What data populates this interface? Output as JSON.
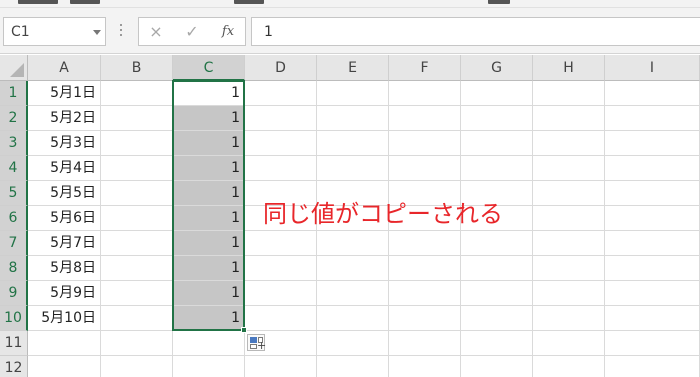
{
  "name_box": {
    "value": "C1"
  },
  "formula_bar": {
    "cancel_icon": "×",
    "enter_icon": "✓",
    "function_icon": "fx",
    "value": "1"
  },
  "columns": [
    "A",
    "B",
    "C",
    "D",
    "E",
    "F",
    "G",
    "H",
    "I"
  ],
  "selected_column": "C",
  "rows": [
    {
      "num": "1",
      "a": "5月1日",
      "c": "1"
    },
    {
      "num": "2",
      "a": "5月2日",
      "c": "1"
    },
    {
      "num": "3",
      "a": "5月3日",
      "c": "1"
    },
    {
      "num": "4",
      "a": "5月4日",
      "c": "1"
    },
    {
      "num": "5",
      "a": "5月5日",
      "c": "1"
    },
    {
      "num": "6",
      "a": "5月6日",
      "c": "1"
    },
    {
      "num": "7",
      "a": "5月7日",
      "c": "1"
    },
    {
      "num": "8",
      "a": "5月8日",
      "c": "1"
    },
    {
      "num": "9",
      "a": "5月9日",
      "c": "1"
    },
    {
      "num": "10",
      "a": "5月10日",
      "c": "1"
    },
    {
      "num": "11",
      "a": "",
      "c": ""
    },
    {
      "num": "12",
      "a": "",
      "c": ""
    }
  ],
  "annotation": "同じ値がコピーされる",
  "colors": {
    "selection": "#217346",
    "highlight": "#c6c6c6",
    "annotation": "#e8262a"
  }
}
